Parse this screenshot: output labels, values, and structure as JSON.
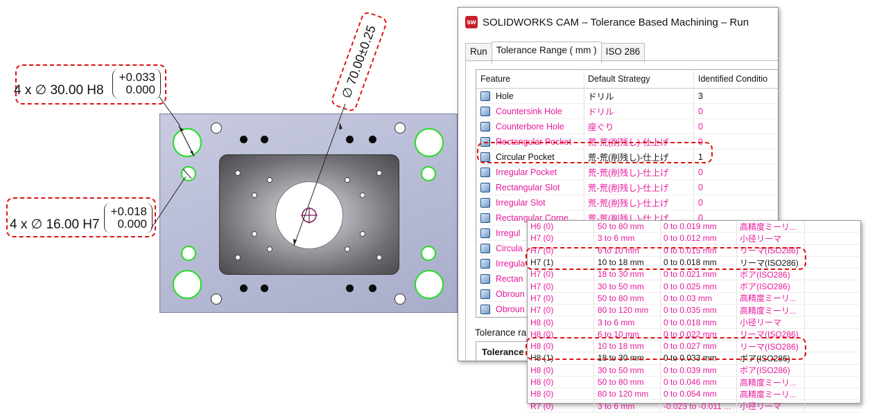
{
  "callouts": {
    "h8": {
      "qty": "4 x",
      "dia_symbol": "∅",
      "size": "30.00 H8",
      "upper": "+0.033",
      "lower": "0.000"
    },
    "h7": {
      "qty": "4 x",
      "dia_symbol": "∅",
      "size": "16.00 H7",
      "upper": "+0.018",
      "lower": "0.000"
    },
    "center": {
      "dia_symbol": "∅",
      "text": "70.00±0.25"
    }
  },
  "window": {
    "title": "SOLIDWORKS CAM – Tolerance Based Machining – Run",
    "app_icon": "sw-logo-icon",
    "tabs": [
      "Run",
      "Tolerance Range ( mm )",
      "ISO 286"
    ],
    "active_tab": "Tolerance Range ( mm )",
    "columns": [
      "Feature",
      "Default Strategy",
      "Identified Conditio"
    ],
    "rows": [
      {
        "feature": "Hole",
        "strategy": "ドリル",
        "count": "3",
        "color": "#111111"
      },
      {
        "feature": "Countersink Hole",
        "strategy": "ドリル",
        "count": "0",
        "color": "#e6189b"
      },
      {
        "feature": "Counterbore Hole",
        "strategy": "座ぐり",
        "count": "0",
        "color": "#e6189b"
      },
      {
        "feature": "Rectangular Pocket",
        "strategy": "荒-荒(削残し)-仕上げ",
        "count": "0",
        "color": "#e6189b"
      },
      {
        "feature": "Circular Pocket",
        "strategy": "荒-荒(削残し)-仕上げ",
        "count": "1",
        "color": "#111111"
      },
      {
        "feature": "Irregular Pocket",
        "strategy": "荒-荒(削残し)-仕上げ",
        "count": "0",
        "color": "#e6189b"
      },
      {
        "feature": "Rectangular Slot",
        "strategy": "荒-荒(削残し)-仕上げ",
        "count": "0",
        "color": "#e6189b"
      },
      {
        "feature": "Irregular Slot",
        "strategy": "荒-荒(削残し)-仕上げ",
        "count": "0",
        "color": "#e6189b"
      },
      {
        "feature": "Rectangular Corne...",
        "strategy": "荒-荒(削残し)-仕上げ",
        "count": "0",
        "color": "#e6189b"
      },
      {
        "feature": "Irregul",
        "strategy": "",
        "count": "",
        "color": "#e6189b"
      },
      {
        "feature": "Circula",
        "strategy": "",
        "count": "",
        "color": "#e6189b"
      },
      {
        "feature": "Irregula",
        "strategy": "",
        "count": "",
        "color": "#e6189b"
      },
      {
        "feature": "Rectan",
        "strategy": "",
        "count": "",
        "color": "#e6189b"
      },
      {
        "feature": "Obroun",
        "strategy": "",
        "count": "",
        "color": "#e6189b"
      },
      {
        "feature": "Obroun",
        "strategy": "",
        "count": "",
        "color": "#e6189b"
      }
    ],
    "tolerance_label": "Tolerance ra",
    "tolerance_header": "Tolerance"
  },
  "overlay": {
    "rows": [
      {
        "grade": "H6 (0)",
        "range": "50 to 80 mm",
        "tol": "0 to 0.019 mm",
        "strategy": "高精度ミーリ...",
        "color": "#e6189b"
      },
      {
        "grade": "H7 (0)",
        "range": "3 to 6 mm",
        "tol": "0 to 0.012 mm",
        "strategy": "小径リーマ",
        "color": "#e6189b"
      },
      {
        "grade": "H7 (0)",
        "range": "6 to 10 mm",
        "tol": "0 to 0.015 mm",
        "strategy": "リーマ(ISO286)",
        "color": "#e6189b"
      },
      {
        "grade": "H7 (1)",
        "range": "10 to 18 mm",
        "tol": "0 to 0.018 mm",
        "strategy": "リーマ(ISO286)",
        "color": "#111111"
      },
      {
        "grade": "H7 (0)",
        "range": "18 to 30 mm",
        "tol": "0 to 0.021 mm",
        "strategy": "ボア(ISO286)",
        "color": "#e6189b"
      },
      {
        "grade": "H7 (0)",
        "range": "30 to 50 mm",
        "tol": "0 to 0.025 mm",
        "strategy": "ボア(ISO286)",
        "color": "#e6189b"
      },
      {
        "grade": "H7 (0)",
        "range": "50 to 80 mm",
        "tol": "0 to 0.03 mm",
        "strategy": "高精度ミーリ...",
        "color": "#e6189b"
      },
      {
        "grade": "H7 (0)",
        "range": "80 to 120 mm",
        "tol": "0 to 0.035 mm",
        "strategy": "高精度ミーリ...",
        "color": "#e6189b"
      },
      {
        "grade": "H8 (0)",
        "range": "3 to 6 mm",
        "tol": "0 to 0.018 mm",
        "strategy": "小径リーマ",
        "color": "#e6189b"
      },
      {
        "grade": "H8 (0)",
        "range": "6 to 10 mm",
        "tol": "0 to 0.022 mm",
        "strategy": "リーマ(ISO286)",
        "color": "#e6189b"
      },
      {
        "grade": "H8 (0)",
        "range": "10 to 18 mm",
        "tol": "0 to 0.027 mm",
        "strategy": "リーマ(ISO286)",
        "color": "#e6189b"
      },
      {
        "grade": "H8 (1)",
        "range": "18 to 30 mm",
        "tol": "0 to 0.033 mm",
        "strategy": "ボア(ISO286)",
        "color": "#111111"
      },
      {
        "grade": "H8 (0)",
        "range": "30 to 50 mm",
        "tol": "0 to 0.039 mm",
        "strategy": "ボア(ISO286)",
        "color": "#e6189b"
      },
      {
        "grade": "H8 (0)",
        "range": "50 to 80 mm",
        "tol": "0 to 0.046 mm",
        "strategy": "高精度ミーリ...",
        "color": "#e6189b"
      },
      {
        "grade": "H8 (0)",
        "range": "80 to 120 mm",
        "tol": "0 to 0.054 mm",
        "strategy": "高精度ミーリ...",
        "color": "#e6189b"
      },
      {
        "grade": "R7 (0)",
        "range": "3 to 6 mm",
        "tol": "-0.023 to -0.011 ...",
        "strategy": "小径リーマ",
        "color": "#e6189b"
      }
    ]
  },
  "colors": {
    "highlight": "#e01010",
    "unassigned": "#e6189b",
    "hole_outline": "#22dd22"
  }
}
